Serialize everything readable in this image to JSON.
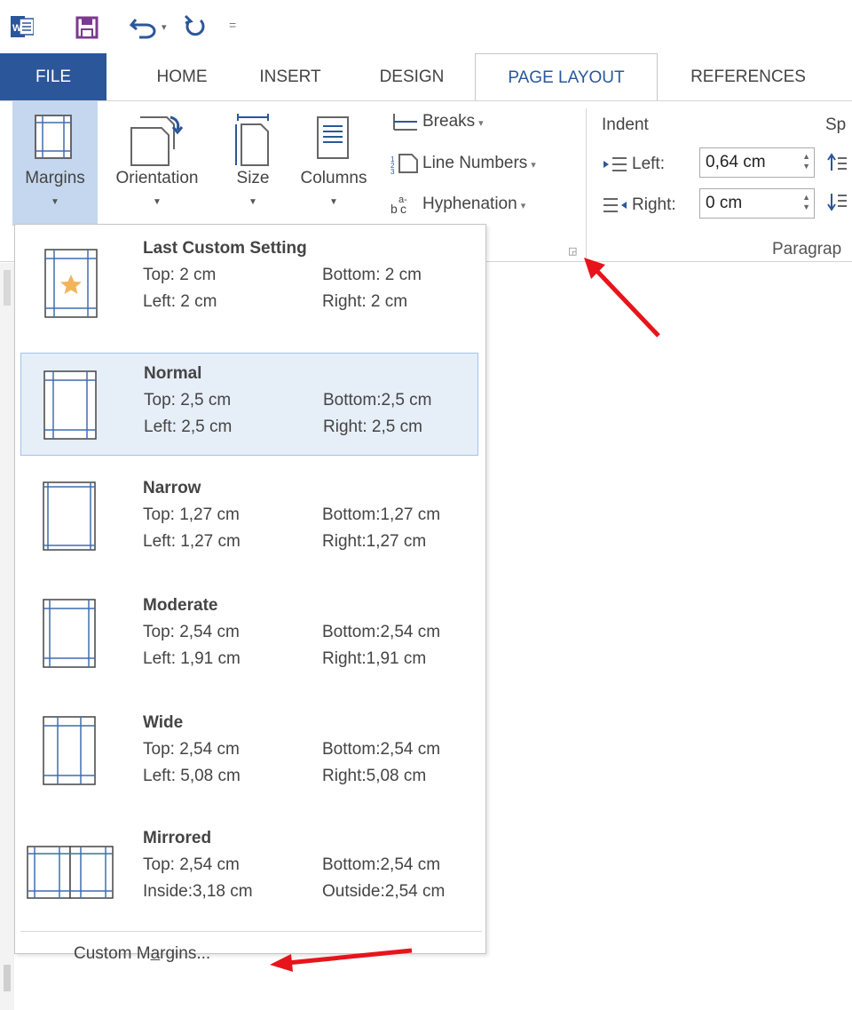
{
  "quick_access": {
    "undo_dropdown": "▾",
    "customize": "="
  },
  "tabs": [
    "FILE",
    "HOME",
    "INSERT",
    "DESIGN",
    "PAGE LAYOUT",
    "REFERENCES"
  ],
  "ribbon": {
    "margins": "Margins",
    "orientation": "Orientation",
    "size": "Size",
    "columns": "Columns",
    "breaks": "Breaks",
    "line_numbers": "Line Numbers",
    "hyphenation": "Hyphenation",
    "indent_title": "Indent",
    "spacing_title_partial": "Sp",
    "indent_left_label": "Left:",
    "indent_left_value": "0,64 cm",
    "indent_right_label": "Right:",
    "indent_right_value": "0 cm",
    "paragraph_group_partial": "Paragrap"
  },
  "margins_menu": {
    "options": [
      {
        "name": "Last Custom Setting",
        "top": "Top:      2 cm",
        "left": "Left:      2 cm",
        "bottom": "Bottom: 2 cm",
        "right": "Right:    2 cm"
      },
      {
        "name": "Normal",
        "top": "Top:   2,5 cm",
        "left": "Left:   2,5 cm",
        "bottom": "Bottom:2,5 cm",
        "right": "Right: 2,5 cm"
      },
      {
        "name": "Narrow",
        "top": "Top: 1,27 cm",
        "left": "Left: 1,27 cm",
        "bottom": "Bottom:1,27 cm",
        "right": "Right:1,27 cm"
      },
      {
        "name": "Moderate",
        "top": "Top: 2,54 cm",
        "left": "Left: 1,91 cm",
        "bottom": "Bottom:2,54 cm",
        "right": "Right:1,91 cm"
      },
      {
        "name": "Wide",
        "top": "Top: 2,54 cm",
        "left": "Left: 5,08 cm",
        "bottom": "Bottom:2,54 cm",
        "right": "Right:5,08 cm"
      },
      {
        "name": "Mirrored",
        "top": "Top: 2,54 cm",
        "left": "Inside:3,18 cm",
        "bottom": "Bottom:2,54 cm",
        "right": "Outside:2,54 cm"
      }
    ],
    "custom_before": "Custom M",
    "custom_underlined": "a",
    "custom_after": "rgins..."
  },
  "colors": {
    "file_tab": "#2b579a",
    "selected_button": "#c5d7ee",
    "annotation_arrow": "#e8141b",
    "icon_blue": "#3f6db0",
    "star": "#f2b45a"
  }
}
